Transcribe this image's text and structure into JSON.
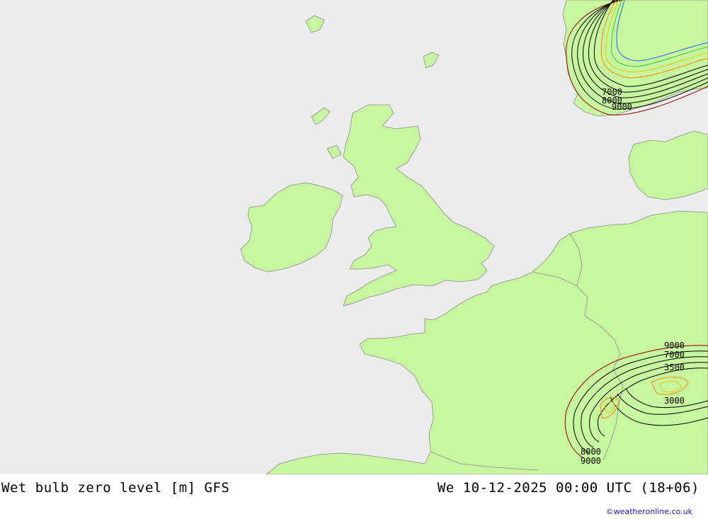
{
  "header": {
    "title": "Wet bulb zero level [m] GFS",
    "datetime": "We 10-12-2025 00:00 UTC (18+06)"
  },
  "credit": "©weatheronline.co.uk",
  "colors": {
    "sea": "#ececec",
    "land": "#c8f5a0",
    "coast": "#8c8c8c",
    "contour_main": "#000000",
    "contour_high": "#8b0000",
    "contour_orange": "#ff8c00",
    "contour_yellow": "#e6c800",
    "contour_green": "#32cd32",
    "contour_blue": "#1e64ff"
  },
  "contour_labels": {
    "norway_9000": "9000",
    "norway_8000": "8000",
    "norway_7000": "7000",
    "alps_9000": "9000",
    "alps_7000": "7000",
    "alps_3500": "3500",
    "alps_3000": "3000",
    "pyrenees_9000": "9000",
    "pyrenees_8000": "8000"
  }
}
